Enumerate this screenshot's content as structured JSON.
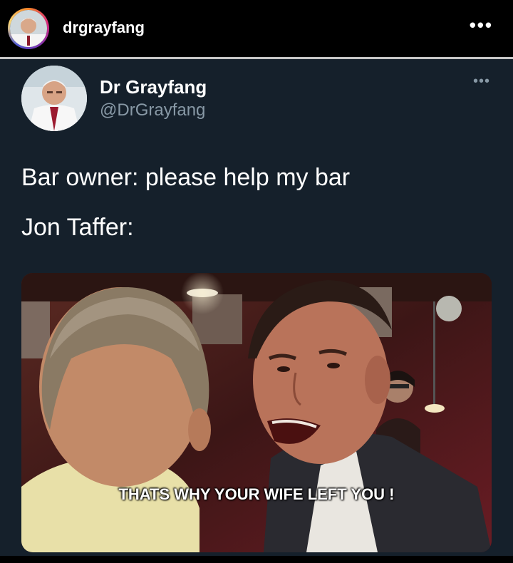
{
  "instagram": {
    "username": "drgrayfang",
    "more_label": "•••"
  },
  "tweet": {
    "display_name": "Dr Grayfang",
    "handle": "@DrGrayfang",
    "more_label": "•••",
    "lines": [
      "Bar owner: please help my bar",
      "Jon Taffer:"
    ],
    "media": {
      "caption": "THATS WHY YOUR WIFE LEFT YOU !"
    }
  },
  "colors": {
    "tweet_background": "#15202b",
    "handle_gray": "#8899a6"
  }
}
